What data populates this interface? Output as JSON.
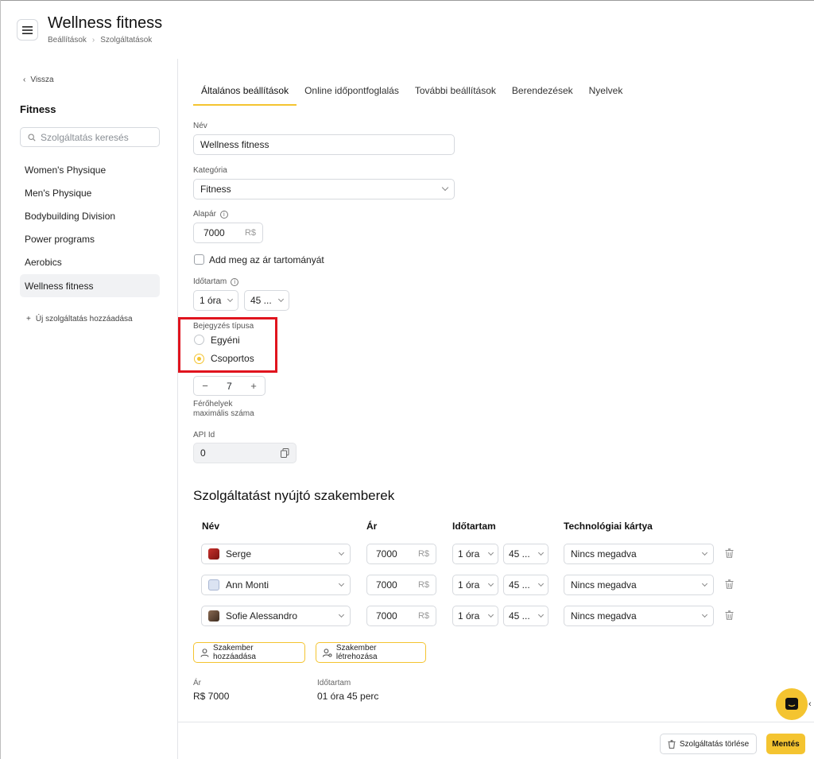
{
  "header": {
    "title": "Wellness fitness",
    "breadcrumb": [
      "Beállítások",
      "Szolgáltatások"
    ]
  },
  "sidebar": {
    "back_label": "Vissza",
    "title": "Fitness",
    "search_placeholder": "Szolgáltatás keresés",
    "items": [
      {
        "label": "Women's Physique"
      },
      {
        "label": "Men's Physique"
      },
      {
        "label": "Bodybuilding Division"
      },
      {
        "label": "Power programs"
      },
      {
        "label": "Aerobics"
      },
      {
        "label": "Wellness fitness",
        "active": true
      }
    ],
    "add_label": "Új szolgáltatás hozzáadása"
  },
  "tabs": [
    {
      "label": "Általános beállítások",
      "active": true
    },
    {
      "label": "Online időpontfoglalás"
    },
    {
      "label": "További beállítások"
    },
    {
      "label": "Berendezések"
    },
    {
      "label": "Nyelvek"
    }
  ],
  "form": {
    "name_label": "Név",
    "name_value": "Wellness fitness",
    "category_label": "Kategória",
    "category_value": "Fitness",
    "price_label": "Alapár",
    "price_value": "7000",
    "currency": "R$",
    "price_range_label": "Add meg az ár tartományát",
    "price_range_checked": false,
    "duration_label": "Időtartam",
    "duration_hours": "1 óra",
    "duration_minutes": "45 ...",
    "booking_type_label": "Bejegyzés típusa",
    "booking_options": [
      {
        "label": "Egyéni",
        "selected": false
      },
      {
        "label": "Csoportos",
        "selected": true
      }
    ],
    "capacity_value": "7",
    "capacity_minus": "−",
    "capacity_plus": "+",
    "capacity_label_line1": "Férőhelyek",
    "capacity_label_line2": "maximális száma",
    "api_label": "API Id",
    "api_value": "0"
  },
  "specialists": {
    "title": "Szolgáltatást nyújtó szakemberek",
    "columns": [
      "Név",
      "Ár",
      "Időtartam",
      "Technológiai kártya"
    ],
    "rows": [
      {
        "name": "Serge",
        "price": "7000",
        "currency": "R$",
        "hours": "1 óra",
        "minutes": "45 ...",
        "card": "Nincs megadva"
      },
      {
        "name": "Ann Monti",
        "price": "7000",
        "currency": "R$",
        "hours": "1 óra",
        "minutes": "45 ...",
        "card": "Nincs megadva"
      },
      {
        "name": "Sofie Alessandro",
        "price": "7000",
        "currency": "R$",
        "hours": "1 óra",
        "minutes": "45 ...",
        "card": "Nincs megadva"
      }
    ],
    "add_button": "Szakember hozzáadása",
    "create_button": "Szakember létrehozása"
  },
  "summary": {
    "price_label": "Ár",
    "price_value": "R$ 7000",
    "duration_label": "Időtartam",
    "duration_value": "01 óra 45 perc"
  },
  "footer": {
    "delete_label": "Szolgáltatás törlése",
    "save_label": "Mentés"
  },
  "colors": {
    "accent": "#f4c430",
    "highlight": "#e0141e"
  }
}
